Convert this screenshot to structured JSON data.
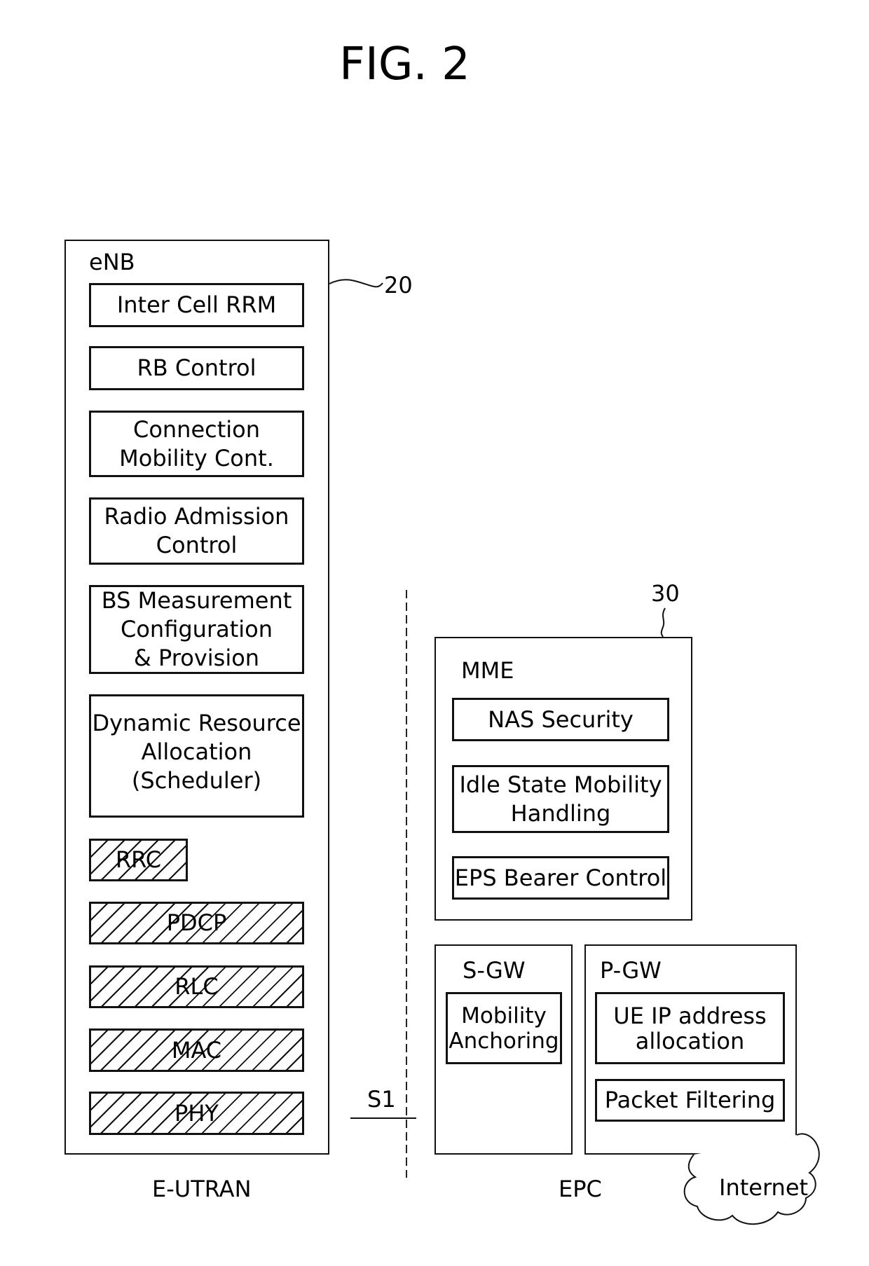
{
  "figure": {
    "title": "FIG. 2"
  },
  "e_utran": {
    "section_label": "E-UTRAN",
    "enb": {
      "label": "eNB",
      "reference_number": "20",
      "functions": [
        {
          "label": "Inter Cell RRM"
        },
        {
          "label": "RB Control"
        },
        {
          "label": "Connection\nMobility Cont."
        },
        {
          "label": "Radio Admission\nControl"
        },
        {
          "label": "BS Measurement\nConfiguration\n& Provision"
        },
        {
          "label": "Dynamic Resource\nAllocation\n(Scheduler)"
        }
      ],
      "protocol_layers": [
        {
          "label": "RRC"
        },
        {
          "label": "PDCP"
        },
        {
          "label": "RLC"
        },
        {
          "label": "MAC"
        },
        {
          "label": "PHY"
        }
      ]
    }
  },
  "interface": {
    "label": "S1"
  },
  "epc": {
    "section_label": "EPC",
    "reference_number": "30",
    "mme": {
      "label": "MME",
      "functions": [
        {
          "label": "NAS Security"
        },
        {
          "label": "Idle State Mobility\nHandling"
        },
        {
          "label": "EPS Bearer Control"
        }
      ]
    },
    "s_gw": {
      "label": "S-GW",
      "functions": [
        {
          "label": "Mobility\nAnchoring"
        }
      ]
    },
    "p_gw": {
      "label": "P-GW",
      "functions": [
        {
          "label": "UE IP address\nallocation"
        },
        {
          "label": "Packet Filtering"
        }
      ]
    }
  },
  "internet": {
    "label": "Internet"
  }
}
